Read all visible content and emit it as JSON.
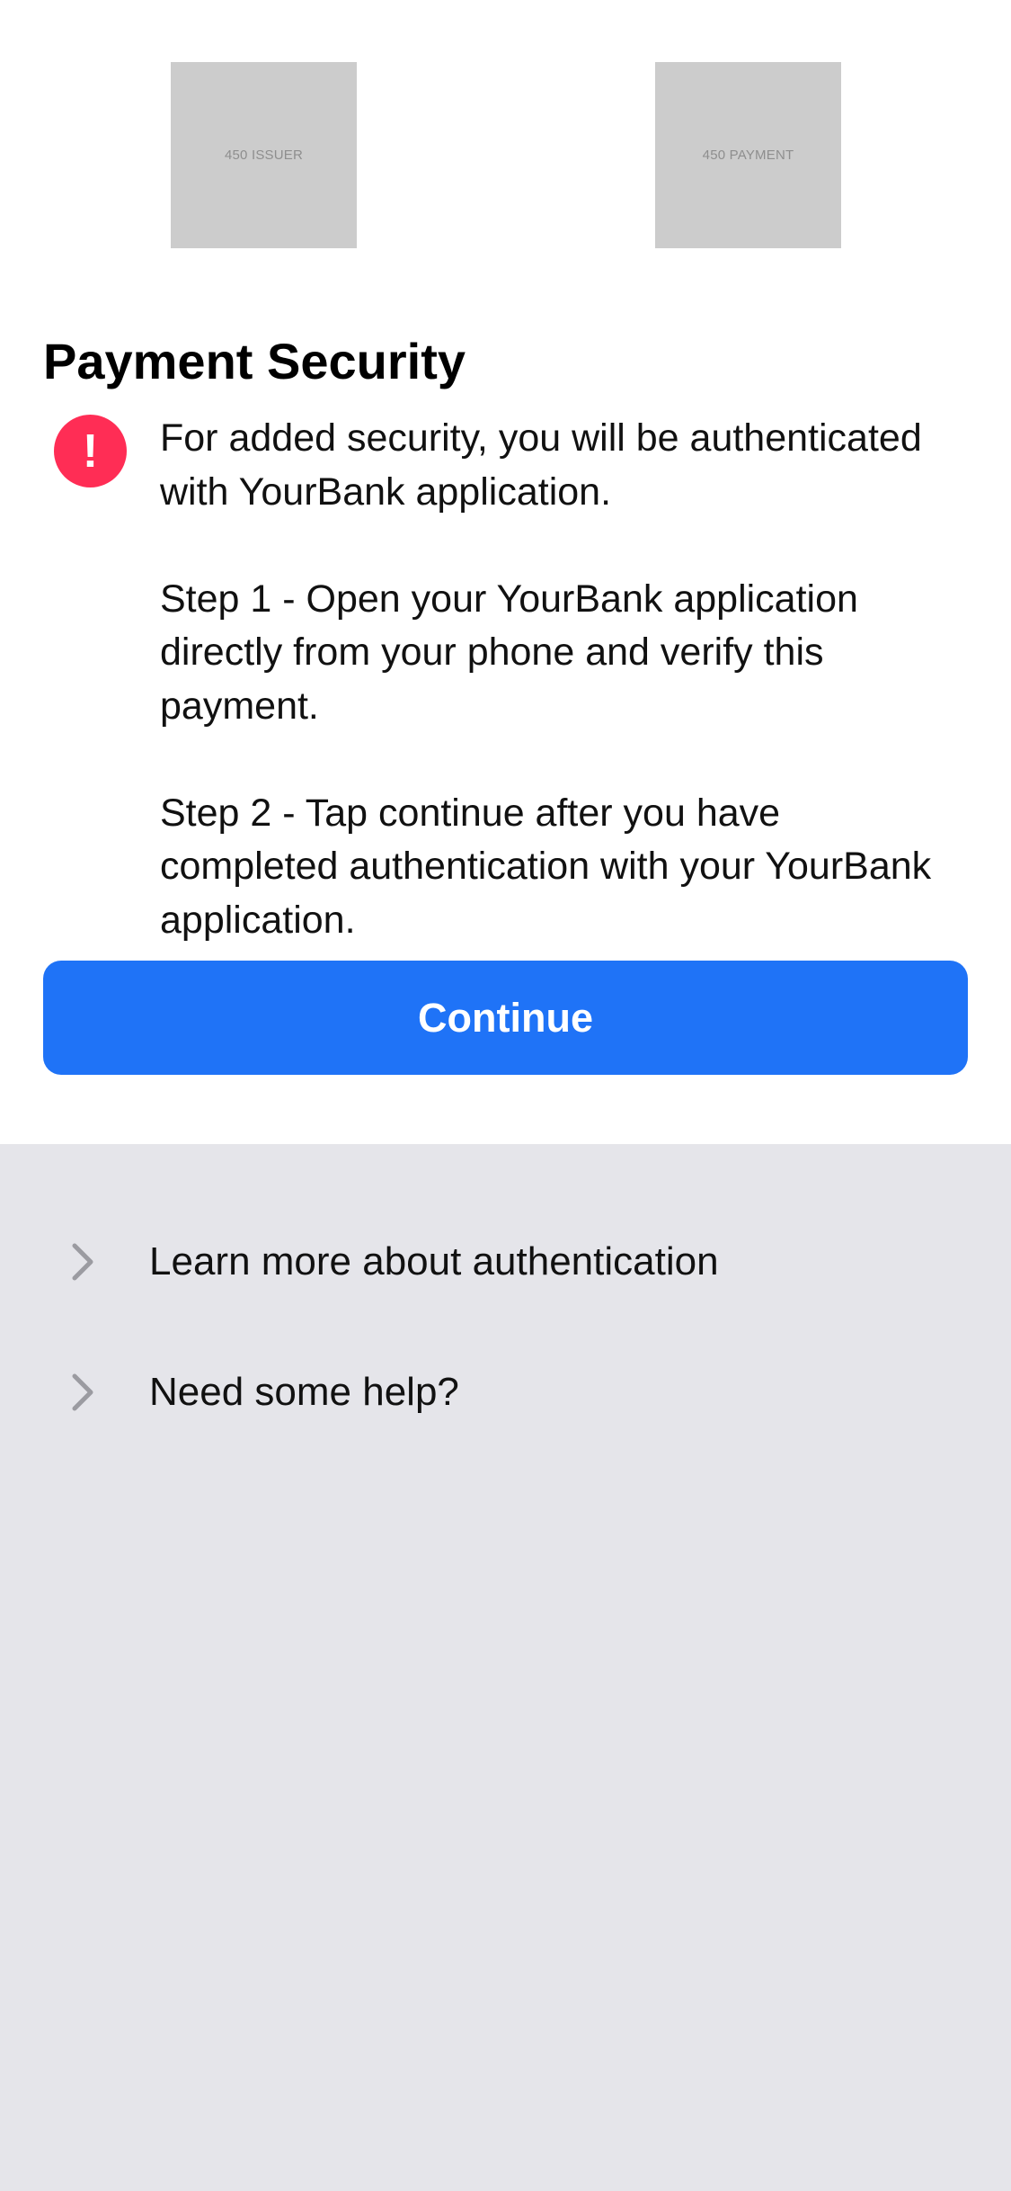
{
  "logos": {
    "issuer_label": "450 ISSUER",
    "payment_label": "450 PAYMENT"
  },
  "page": {
    "title": "Payment Security"
  },
  "alert": {
    "icon": "exclamation-icon",
    "glyph": "!",
    "color": "#ff2d55"
  },
  "message": {
    "intro": "For added security, you will be authenticated with YourBank application.",
    "step1": "Step 1 - Open your YourBank application directly from your phone and verify this payment.",
    "step2": "Step 2 - Tap continue after you have completed authentication with your YourBank application."
  },
  "actions": {
    "continue_label": "Continue",
    "accent_color": "#1f73f7"
  },
  "help": {
    "items": [
      {
        "label": "Learn more about authentication",
        "icon": "chevron-right-icon"
      },
      {
        "label": "Need some help?",
        "icon": "chevron-right-icon"
      }
    ]
  },
  "colors": {
    "header_background": "#ffffff",
    "footer_background": "#e5e5ea"
  }
}
